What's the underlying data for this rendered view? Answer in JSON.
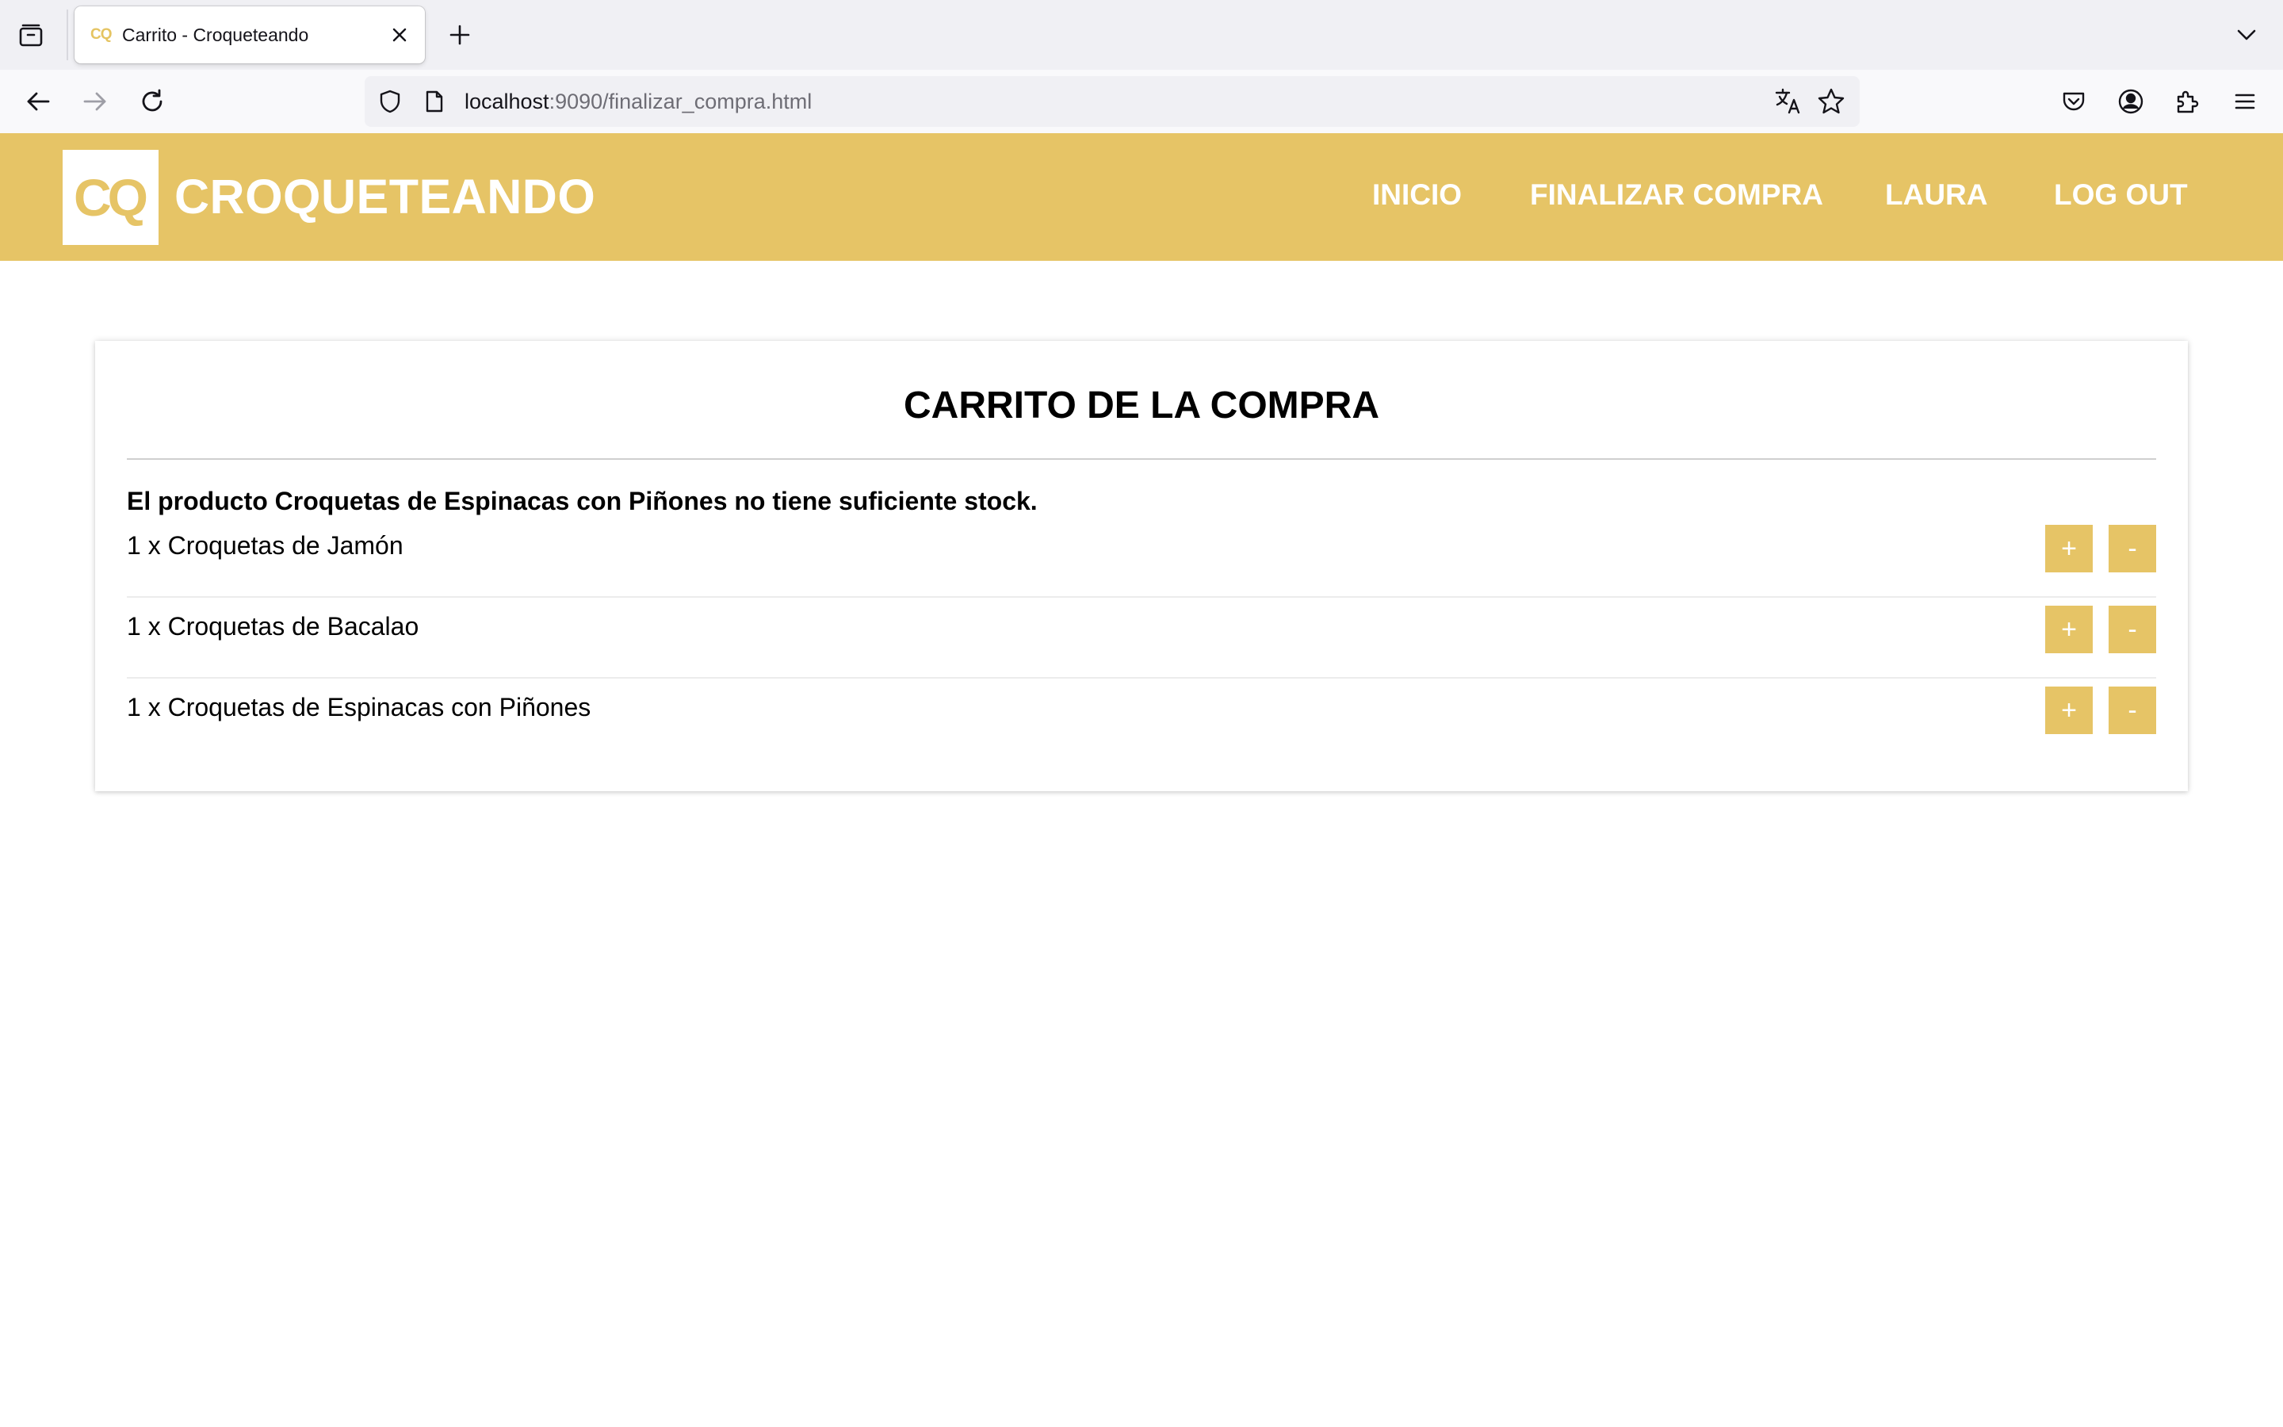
{
  "browser": {
    "tab_title": "Carrito - Croqueteando",
    "tab_favicon_text": "CQ",
    "url_host": "localhost",
    "url_rest": ":9090/finalizar_compra.html",
    "icons": {
      "tab_manager": "tab-manager-icon",
      "close_tab": "close-icon",
      "new_tab": "plus-icon",
      "tab_list": "chevron-down-icon",
      "back": "arrow-left-icon",
      "forward": "arrow-right-icon",
      "reload": "reload-icon",
      "shield": "shield-icon",
      "page": "page-icon",
      "translate": "translate-icon",
      "bookmark": "star-icon",
      "pocket": "pocket-icon",
      "account": "account-icon",
      "extensions": "puzzle-icon",
      "menu": "hamburger-menu-icon"
    }
  },
  "site": {
    "logo_text": "CQ",
    "name": "CROQUETEANDO",
    "brand_color": "#e6c466",
    "menu": {
      "inicio": "INICIO",
      "finalizar": "FINALIZAR COMPRA",
      "user": "LAURA",
      "logout": "LOG OUT"
    }
  },
  "cart": {
    "title": "CARRITO DE LA COMPRA",
    "message": "El producto Croquetas de Espinacas con Piñones no tiene suficiente stock.",
    "items": [
      {
        "label": "1 x Croquetas de Jamón",
        "plus": "+",
        "minus": "-"
      },
      {
        "label": "1 x Croquetas de Bacalao",
        "plus": "+",
        "minus": "-"
      },
      {
        "label": "1 x Croquetas de Espinacas con Piñones",
        "plus": "+",
        "minus": "-"
      }
    ]
  }
}
